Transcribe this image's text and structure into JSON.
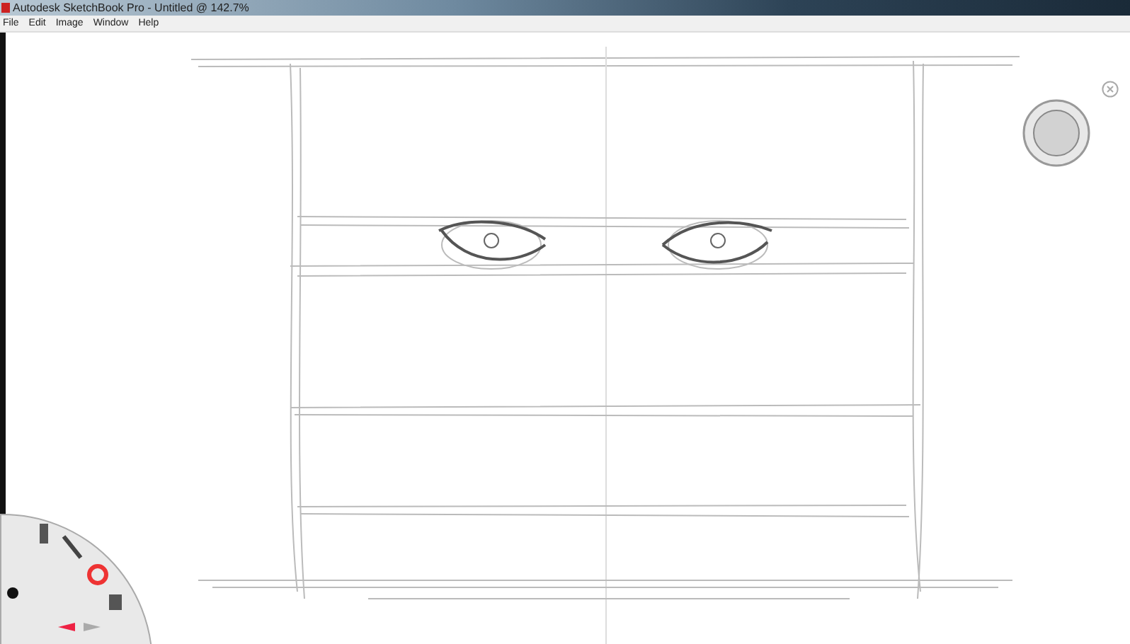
{
  "window": {
    "title": "Autodesk SketchBook Pro - Untitled @ 142.7%"
  },
  "menu": [
    "File",
    "Edit",
    "Image",
    "Window",
    "Help"
  ]
}
